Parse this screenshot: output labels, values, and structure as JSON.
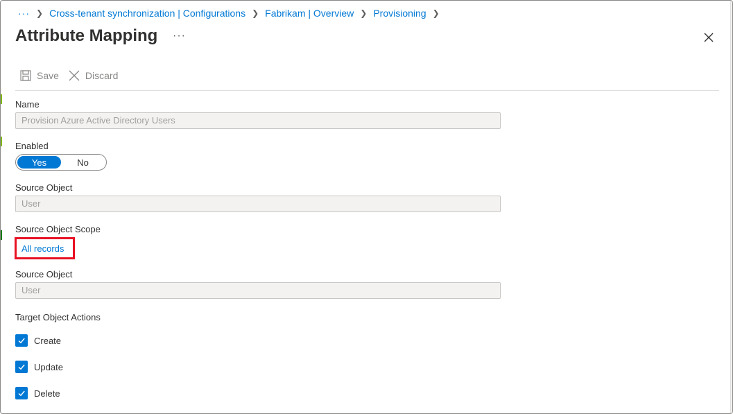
{
  "breadcrumb": {
    "items": [
      "Cross-tenant synchronization | Configurations",
      "Fabrikam | Overview",
      "Provisioning"
    ]
  },
  "header": {
    "title": "Attribute Mapping",
    "more_label": "···"
  },
  "toolbar": {
    "save_label": "Save",
    "discard_label": "Discard"
  },
  "form": {
    "name": {
      "label": "Name",
      "value": "Provision Azure Active Directory Users"
    },
    "enabled": {
      "label": "Enabled",
      "yes_label": "Yes",
      "no_label": "No",
      "selected": "Yes"
    },
    "source_object": {
      "label": "Source Object",
      "value": "User"
    },
    "source_object_scope": {
      "label": "Source Object Scope",
      "link": "All records"
    },
    "source_object_2": {
      "label": "Source Object",
      "value": "User"
    },
    "target_object_actions": {
      "label": "Target Object Actions",
      "items": [
        {
          "label": "Create",
          "checked": true
        },
        {
          "label": "Update",
          "checked": true
        },
        {
          "label": "Delete",
          "checked": true
        }
      ]
    }
  },
  "colors": {
    "accent": "#0078d4",
    "highlight": "#e81123"
  }
}
